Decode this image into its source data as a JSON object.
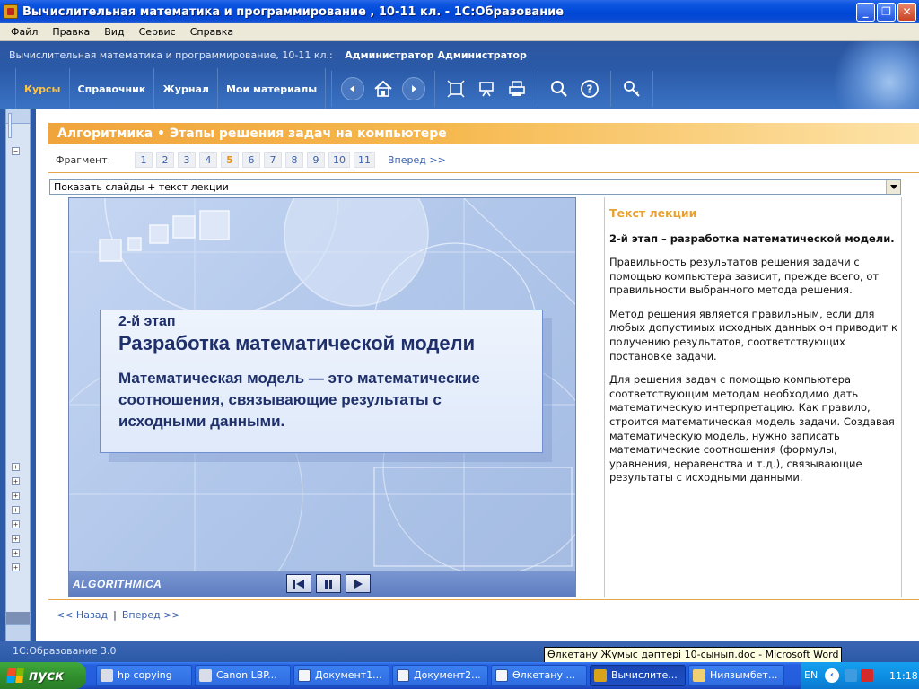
{
  "window": {
    "title": "Вычислительная математика и программирование , 10-11 кл. - 1С:Образование",
    "min_glyph": "_",
    "max_glyph": "❐",
    "close_glyph": "✕"
  },
  "menu": [
    "Файл",
    "Правка",
    "Вид",
    "Сервис",
    "Справка"
  ],
  "header": {
    "course": "Вычислительная математика и программирование, 10-11 кл.:",
    "user": "Администратор Администратор",
    "nav": [
      "Курсы",
      "Справочник",
      "Журнал",
      "Мои материалы"
    ],
    "active_nav": "Курсы",
    "tools": [
      "back-arrow-icon",
      "home-icon",
      "forward-arrow-icon",
      "fullscreen-icon",
      "presentation-icon",
      "print-icon",
      "search-icon",
      "help-icon",
      "settings-icon"
    ]
  },
  "lesson": {
    "title": "Алгоритмика • Этапы решения задач на компьютере",
    "fragment_label": "Фрагмент:",
    "fragments": [
      "1",
      "2",
      "3",
      "4",
      "5",
      "6",
      "7",
      "8",
      "9",
      "10",
      "11"
    ],
    "active_fragment": "5",
    "next_label": "Вперед >>",
    "view_mode": "Показать слайды + текст лекции"
  },
  "slide": {
    "stage": "2-й этап",
    "heading": "Разработка математической модели",
    "definition": "Математическая модель — это математические соотношения, связывающие результаты с исходными данными.",
    "brand": "ALGORITHMICA",
    "controls": [
      "first-icon",
      "pause-icon",
      "play-icon"
    ]
  },
  "lecture": {
    "heading": "Текст лекции",
    "subheading": "2-й этап – разработка математической модели.",
    "paragraphs": [
      "Правильность результатов решения задачи с помощью компьютера зависит, прежде всего, от правильности выбранного метода решения.",
      "Метод решения является правильным, если для любых допустимых исходных данных он приводит к получению результатов, соответствующих постановке задачи.",
      "Для решения задач с помощью компьютера соответствующим методам необходимо дать математическую интерпретацию. Как правило, строится математическая модель задачи. Создавая математическую модель, нужно записать математические соотношения (формулы, уравнения, неравенства и т.д.), связывающие результаты с исходными данными."
    ]
  },
  "pager": {
    "back": "<< Назад",
    "sep": "|",
    "next": "Вперед >>"
  },
  "status": "1С:Образование 3.0",
  "tooltip": "Өлкетану Жұмыс дәптері 10-сынып.doc - Microsoft Word",
  "taskbar": {
    "start": "пуск",
    "tasks": [
      "hp copying",
      "Canon LBP...",
      "Документ1...",
      "Документ2...",
      "Өлкетану ...",
      "Вычислите...",
      "Ниязымбет..."
    ],
    "active_task": "Вычислите...",
    "lang": "EN",
    "clock": "11:18"
  },
  "colors": {
    "accent_orange": "#f0a43c",
    "header_blue": "#2d56a0",
    "link_blue": "#3a62b0"
  }
}
